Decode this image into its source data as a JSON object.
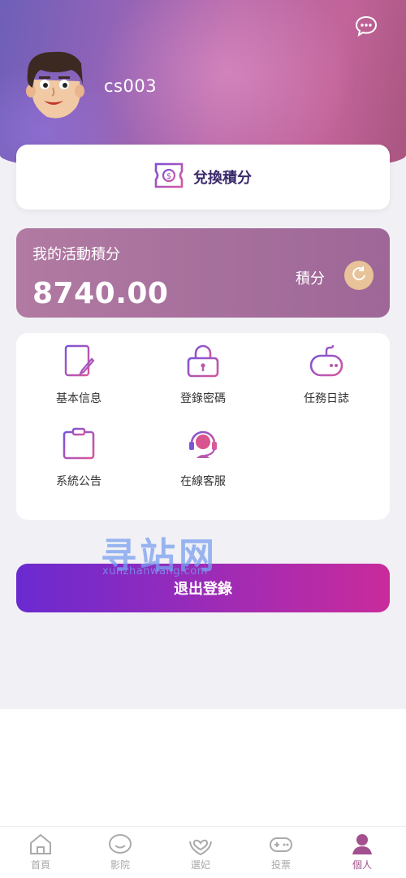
{
  "user": {
    "username": "cs003"
  },
  "header": {
    "chat_icon": "chat-bubble-icon",
    "avatar": "cartoon-avatar"
  },
  "exchange": {
    "label": "兌換積分",
    "icon": "coupon-icon"
  },
  "points": {
    "title": "我的活動積分",
    "value": "8740.00",
    "unit": "積分",
    "refresh_icon": "refresh-icon"
  },
  "menu": {
    "items": [
      {
        "label": "基本信息",
        "icon": "document-edit-icon"
      },
      {
        "label": "登錄密碼",
        "icon": "lock-icon"
      },
      {
        "label": "任務日誌",
        "icon": "gamepad-icon"
      },
      {
        "label": "系統公告",
        "icon": "notice-board-icon"
      },
      {
        "label": "在線客服",
        "icon": "headset-icon"
      }
    ]
  },
  "watermark": {
    "text": "寻站网",
    "sub": "xunzhanwang.com"
  },
  "logout": {
    "label": "退出登錄"
  },
  "tabbar": {
    "tabs": [
      {
        "label": "首頁",
        "icon": "home-icon"
      },
      {
        "label": "影院",
        "icon": "smile-icon"
      },
      {
        "label": "選妃",
        "icon": "heart-hands-icon"
      },
      {
        "label": "投票",
        "icon": "gamepad-icon"
      },
      {
        "label": "個人",
        "icon": "person-icon"
      }
    ],
    "active_index": 4,
    "active_color": "#a2508e",
    "inactive_color": "#aaaaaa"
  },
  "colors": {
    "accent": "#9e6797",
    "logout_start": "#6a2ad0",
    "logout_end": "#c92b9b",
    "refresh_bg": "#e8c39a"
  }
}
